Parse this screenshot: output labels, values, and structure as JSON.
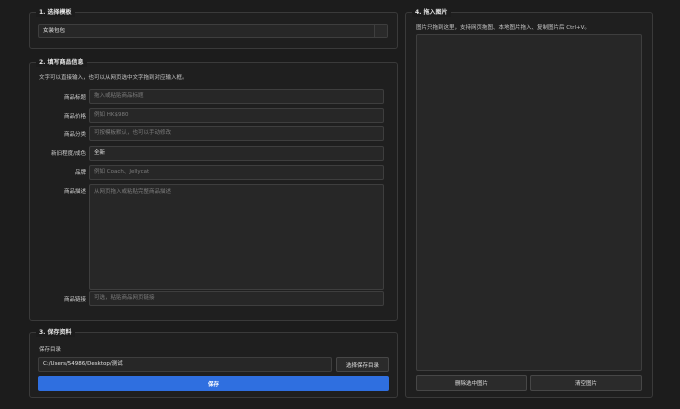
{
  "template_section": {
    "title": "1. 选择模板",
    "selected": "女装包包"
  },
  "info_section": {
    "title": "2. 填写商品信息",
    "hint": "文字可以直接输入，也可以从网页选中文字拖到对应输入框。",
    "fields": [
      {
        "label": "商品标题",
        "value": "",
        "placeholder": "拖入或粘贴商品标题"
      },
      {
        "label": "商品价格",
        "value": "",
        "placeholder": "例如 HK$980"
      },
      {
        "label": "商品分类",
        "value": "",
        "placeholder": "可按模板默认，也可以手动修改"
      },
      {
        "label": "新旧程度/成色",
        "value": "全新",
        "placeholder": ""
      },
      {
        "label": "品牌",
        "value": "",
        "placeholder": "例如 Coach、Jellycat"
      },
      {
        "label": "商品描述",
        "value": "",
        "placeholder": "从网页拖入或粘贴完整商品描述"
      },
      {
        "label": "商品链接",
        "value": "",
        "placeholder": "可选，粘贴商品网页链接"
      }
    ]
  },
  "save_section": {
    "title": "3. 保存资料",
    "dir_label": "保存目录",
    "dir_value": "C:/Users/54986/Desktop/测试",
    "choose_button": "选择保存目录",
    "save_button": "保存"
  },
  "image_section": {
    "title": "4. 拖入图片",
    "hint": "图片只拖到这里，支持网页拖图、本地图片拖入、复制图片后 Ctrl+V。",
    "delete_button": "删除选中图片",
    "clear_button": "清空图片"
  },
  "colors": {
    "accent": "#2f6fe0",
    "background": "#1c1c1c"
  }
}
